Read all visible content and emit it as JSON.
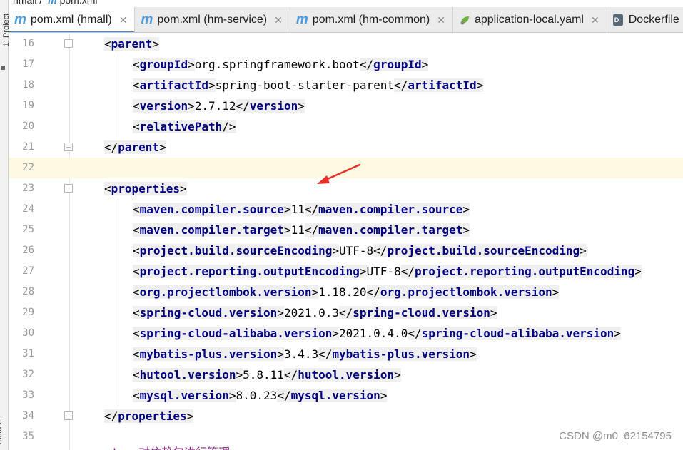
{
  "breadcrumb": {
    "project": "hmall",
    "separator": "/",
    "file": "pom.xml"
  },
  "sidebar": {
    "project_label": "1: Project",
    "structure_label": "ructure"
  },
  "tabs": [
    {
      "label": "pom.xml (hmall)",
      "icon": "maven-icon",
      "active": true
    },
    {
      "label": "pom.xml (hm-service)",
      "icon": "maven-icon",
      "active": false
    },
    {
      "label": "pom.xml (hm-common)",
      "icon": "maven-icon",
      "active": false
    },
    {
      "label": "application-local.yaml",
      "icon": "spring-icon",
      "active": false
    },
    {
      "label": "Dockerfile",
      "icon": "docker-file-icon",
      "active": false
    }
  ],
  "editor": {
    "lines": [
      {
        "num": "16",
        "open": "<",
        "tag": "parent",
        "close": ">"
      },
      {
        "num": "17",
        "tag": "groupId",
        "value": "org.springframework.boot"
      },
      {
        "num": "18",
        "tag": "artifactId",
        "value": "spring-boot-starter-parent"
      },
      {
        "num": "19",
        "tag": "version",
        "value": "2.7.12"
      },
      {
        "num": "20",
        "tag": "relativePath"
      },
      {
        "num": "21",
        "tag": "parent"
      },
      {
        "num": "22"
      },
      {
        "num": "23",
        "tag": "properties"
      },
      {
        "num": "24",
        "tag": "maven.compiler.source",
        "value": "11"
      },
      {
        "num": "25",
        "tag": "maven.compiler.target",
        "value": "11"
      },
      {
        "num": "26",
        "tag": "project.build.sourceEncoding",
        "value": "UTF-8"
      },
      {
        "num": "27",
        "tag": "project.reporting.outputEncoding",
        "value": "UTF-8"
      },
      {
        "num": "28",
        "tag": "org.projectlombok.version",
        "value": "1.18.20"
      },
      {
        "num": "29",
        "tag": "spring-cloud.version",
        "value": "2021.0.3"
      },
      {
        "num": "30",
        "tag": "spring-cloud-alibaba.version",
        "value": "2021.0.4.0"
      },
      {
        "num": "31",
        "tag": "mybatis-plus.version",
        "value": "3.4.3"
      },
      {
        "num": "32",
        "tag": "hutool.version",
        "value": "5.8.11"
      },
      {
        "num": "33",
        "tag": "mysql.version",
        "value": "8.0.23"
      },
      {
        "num": "34",
        "tag": "properties"
      },
      {
        "num": "35"
      }
    ],
    "cutoff_text": "<!-- 对依赖包进行管理"
  },
  "watermark": "CSDN @m0_62154795",
  "colors": {
    "tag": "#000080",
    "tab_accent": "#4083c9",
    "current_line": "#fdf9e3",
    "arrow": "#e8302a"
  }
}
